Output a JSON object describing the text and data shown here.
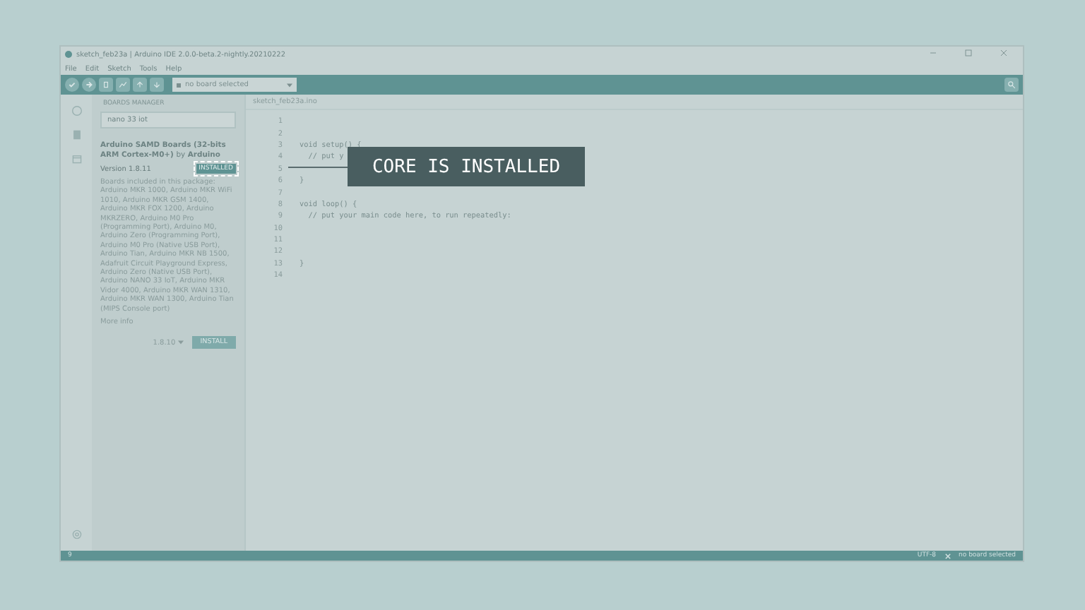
{
  "window": {
    "title": "sketch_feb23a | Arduino IDE 2.0.0-beta.2-nightly.20210222"
  },
  "menu": [
    "File",
    "Edit",
    "Sketch",
    "Tools",
    "Help"
  ],
  "toolbar": {
    "board": "no board selected"
  },
  "boards_manager": {
    "title": "BOARDS MANAGER",
    "search": "nano 33 iot",
    "board": {
      "name": "Arduino SAMD Boards (32-bits ARM Cortex-M0+)",
      "by": "by",
      "author": "Arduino",
      "version": "Version 1.8.11",
      "installed_badge": "INSTALLED",
      "description": "Boards included in this package: Arduino MKR 1000, Arduino MKR WiFi 1010, Arduino MKR GSM 1400, Arduino MKR FOX 1200, Arduino MKRZERO, Arduino M0 Pro (Programming Port), Arduino M0, Arduino Zero (Programming Port), Arduino M0 Pro (Native USB Port), Arduino Tian, Arduino MKR NB 1500, Adafruit Circuit Playground Express, Arduino Zero (Native USB Port), Arduino NANO 33 IoT, Arduino MKR Vidor 4000, Arduino MKR WAN 1310, Arduino MKR WAN 1300, Arduino Tian (MIPS Console port)",
      "more": "More info",
      "select_version": "1.8.10",
      "install": "INSTALL"
    }
  },
  "editor": {
    "tab": "sketch_feb23a.ino",
    "lines": [
      {
        "number": "1"
      },
      {
        "number": "2"
      },
      {
        "number": "3",
        "code": "void setup() {"
      },
      {
        "number": "4",
        "code": "  // put y"
      },
      {
        "number": "5"
      },
      {
        "number": "6",
        "code": "}"
      },
      {
        "number": "7"
      },
      {
        "number": "8",
        "code": "void loop() {"
      },
      {
        "number": "9",
        "code": "  // put your main code here, to run repeatedly:"
      },
      {
        "number": "10"
      },
      {
        "number": "11"
      },
      {
        "number": "12"
      },
      {
        "number": "13",
        "code": "}"
      },
      {
        "number": "14"
      }
    ]
  },
  "status_bar": {
    "line": "9",
    "encoding": "UTF-8",
    "board": "no board selected"
  },
  "callout": "CORE IS INSTALLED"
}
